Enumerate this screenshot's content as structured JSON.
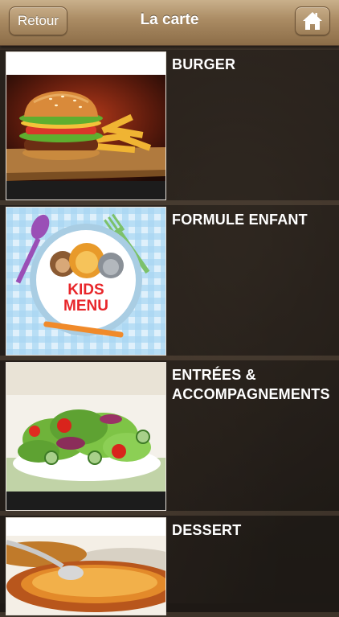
{
  "header": {
    "back_label": "Retour",
    "title": "La carte",
    "home_icon": "home-icon"
  },
  "menu": {
    "items": [
      {
        "label": "BURGER",
        "image": "burger-fries-photo"
      },
      {
        "label": "FORMULE ENFANT",
        "image": "kids-menu-plate-illustration",
        "image_text": "KIDS MENU"
      },
      {
        "label_line1": "ENTRÉES &",
        "label_line2": "ACCOMPAGNEMENTS",
        "image": "salad-bowl-photo"
      },
      {
        "label": "DESSERT",
        "image": "creme-brulee-photo"
      }
    ]
  },
  "colors": {
    "header_top": "#c9b08b",
    "header_bottom": "#8c6d48",
    "label": "#ffffff",
    "background": "#201a16"
  }
}
